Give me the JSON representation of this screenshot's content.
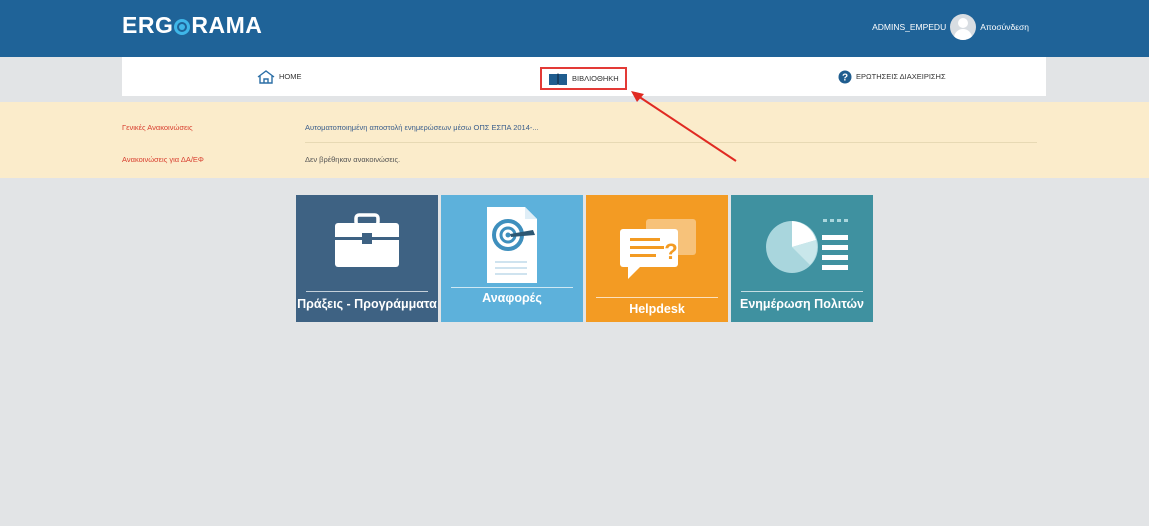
{
  "header": {
    "logo_left": "ERG",
    "logo_right": "RAMA",
    "username": "ADMINS_EMPEDU",
    "logout_label": "Αποσύνδεση"
  },
  "nav": {
    "home": "HOME",
    "library": "ΒΙΒΛΙΟΘΗΚΗ",
    "faq": "ΕΡΩΤΗΣΕΙΣ ΔΙΑΧΕΙΡΙΣΗΣ"
  },
  "announcements": {
    "general_label": "Γενικές Ανακοινώσεις",
    "general_text": "Αυτοματοποιημένη αποστολή ενημερώσεων μέσω ΟΠΣ ΕΣΠΑ 2014-...",
    "dae_label": "Ανακοινώσεις για ΔΑ/ΕΦ",
    "dae_text": "Δεν βρέθηκαν ανακοινώσεις."
  },
  "tiles": [
    {
      "label": "Πράξεις - Προγράμματα",
      "color": "#3e6283",
      "icon": "briefcase-icon"
    },
    {
      "label": "Αναφορές",
      "color": "#5db1db",
      "icon": "report-target-icon"
    },
    {
      "label": "Helpdesk",
      "color": "#f39b23",
      "icon": "chat-question-icon"
    },
    {
      "label": "Ενημέρωση Πολιτών",
      "color": "#3f91a0",
      "icon": "pie-chart-list-icon"
    }
  ],
  "colors": {
    "header_bg": "#1f6398",
    "highlight_box": "#e33a36",
    "announce_bg": "#fbeccb",
    "announce_label": "#d83f2f"
  }
}
